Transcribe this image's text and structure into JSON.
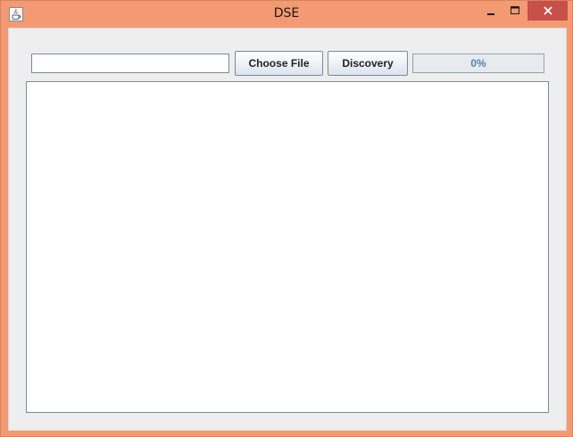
{
  "window": {
    "title": "DSE",
    "frame_color": "#f39a72",
    "close_color": "#c7504a"
  },
  "toolbar": {
    "path_value": "",
    "choose_label": "Choose File",
    "discovery_label": "Discovery",
    "progress_text": "0%",
    "progress_fraction": 0
  },
  "output": {
    "content": ""
  },
  "icons": {
    "app": "java-coffee-cup-icon",
    "minimize": "minimize-icon",
    "maximize": "maximize-icon",
    "close": "close-icon"
  }
}
